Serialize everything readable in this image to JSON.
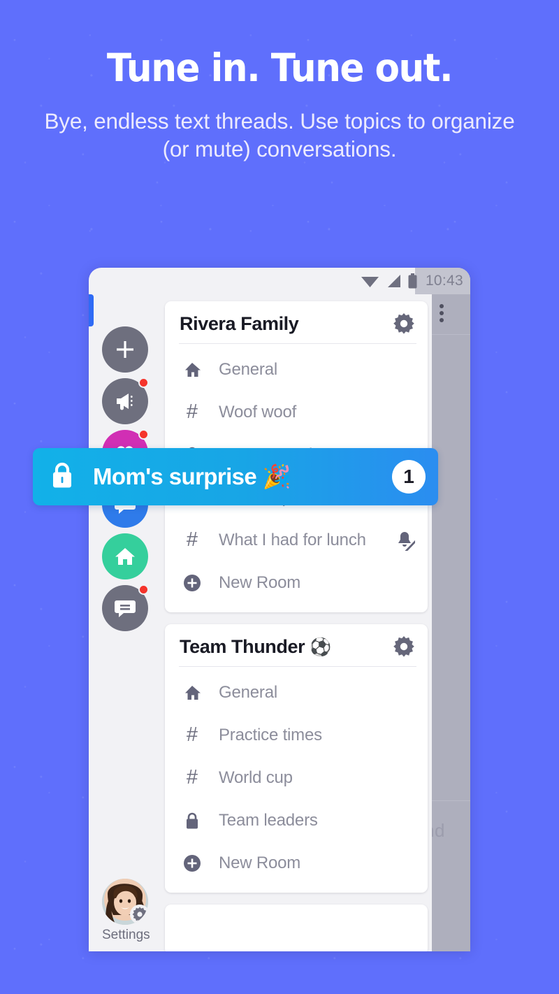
{
  "promo": {
    "headline": "Tune in. Tune out.",
    "subtitle": "Bye, endless text threads. Use topics to organize (or mute) conversations.",
    "background_color": "#5f6ffc",
    "headline_color": "#ffffff"
  },
  "phone": {
    "status_bar": {
      "time": "10:43",
      "icons": [
        "wifi-icon",
        "cell-signal-icon",
        "battery-icon"
      ]
    },
    "background_pane": {
      "overflow_menu": "overflow-menu-icon",
      "ghost_text": "nd"
    }
  },
  "rail": {
    "items": [
      {
        "name": "add-group-button",
        "icon": "plus-icon",
        "color": "#6e6f7e",
        "badge": false
      },
      {
        "name": "rail-item-megaphone",
        "icon": "megaphone-icon",
        "color": "#6e6f7e",
        "badge": true
      },
      {
        "name": "rail-item-heart",
        "icon": "heart-icon",
        "color": "#d12fb4",
        "badge": true
      },
      {
        "name": "rail-item-chat-blue",
        "icon": "chat-icon",
        "color": "#2f7bea",
        "badge": false
      },
      {
        "name": "rail-item-home",
        "icon": "home-icon",
        "color": "#35cf9c",
        "badge": false
      },
      {
        "name": "rail-item-messages",
        "icon": "message-icon",
        "color": "#6e6f7e",
        "badge": true
      }
    ],
    "selected_index": 3,
    "indicator_color": "#2f6bf5",
    "settings": {
      "label": "Settings",
      "avatar": "user-avatar",
      "badge_icon": "gear-icon"
    }
  },
  "groups": [
    {
      "title": "Rivera Family",
      "emoji": "",
      "settings_icon": "gear-icon",
      "rooms": [
        {
          "name": "General",
          "icon": "home-icon",
          "muted": false
        },
        {
          "name": "Woof woof",
          "icon": "hash-icon",
          "muted": false
        },
        {
          "name": "Mom's surprise",
          "icon": "lock-icon",
          "muted": false,
          "hidden_behind_highlight": true
        },
        {
          "name": "Oahu Trip",
          "icon": "hash-icon",
          "muted": false
        },
        {
          "name": "What I had for lunch",
          "icon": "hash-icon",
          "muted": true
        },
        {
          "name": "New Room",
          "icon": "plus-circle-icon",
          "muted": false
        }
      ]
    },
    {
      "title": "Team Thunder",
      "emoji": "⚽",
      "settings_icon": "gear-icon",
      "rooms": [
        {
          "name": "General",
          "icon": "home-icon",
          "muted": false
        },
        {
          "name": "Practice times",
          "icon": "hash-icon",
          "muted": false
        },
        {
          "name": "World cup",
          "icon": "hash-icon",
          "muted": false
        },
        {
          "name": "Team leaders",
          "icon": "lock-icon",
          "muted": false
        },
        {
          "name": "New Room",
          "icon": "plus-circle-icon",
          "muted": false
        }
      ]
    }
  ],
  "highlight": {
    "label": "Mom's surprise 🎉",
    "badge_count": "1",
    "icon": "lock-icon",
    "color": "#18a5e6",
    "text_color": "#ffffff"
  }
}
